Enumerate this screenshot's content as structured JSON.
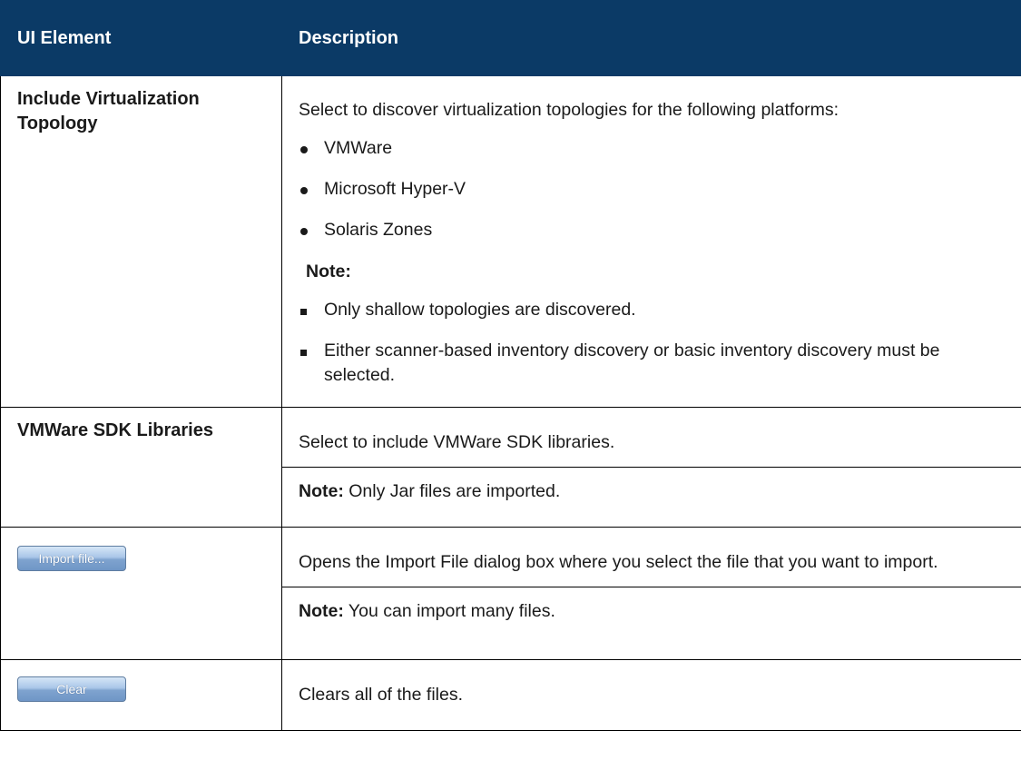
{
  "header": {
    "col1": "UI Element",
    "col2": "Description"
  },
  "rows": {
    "virtualization": {
      "element": "Include Virtualization Topology",
      "intro": "Select to discover virtualization topologies for the following platforms:",
      "platforms": [
        "VMWare",
        "Microsoft Hyper-V",
        "Solaris Zones"
      ],
      "note_label": "Note:",
      "notes": [
        "Only shallow topologies are discovered.",
        "Either scanner-based inventory discovery or basic inventory discovery must be selected."
      ]
    },
    "sdk": {
      "element": "VMWare SDK Libraries",
      "description": "Select to include VMWare SDK libraries.",
      "note_label": "Note:",
      "note": " Only Jar files are imported."
    },
    "import": {
      "button_label": "Import file...",
      "description": "Opens the Import File dialog box where you select the file that you want to import.",
      "note_label": "Note:",
      "note": " You can import many files."
    },
    "clear": {
      "button_label": "Clear",
      "description": "Clears all of the files."
    }
  },
  "colors": {
    "header_bg": "#0b3a66",
    "header_text": "#ffffff"
  }
}
